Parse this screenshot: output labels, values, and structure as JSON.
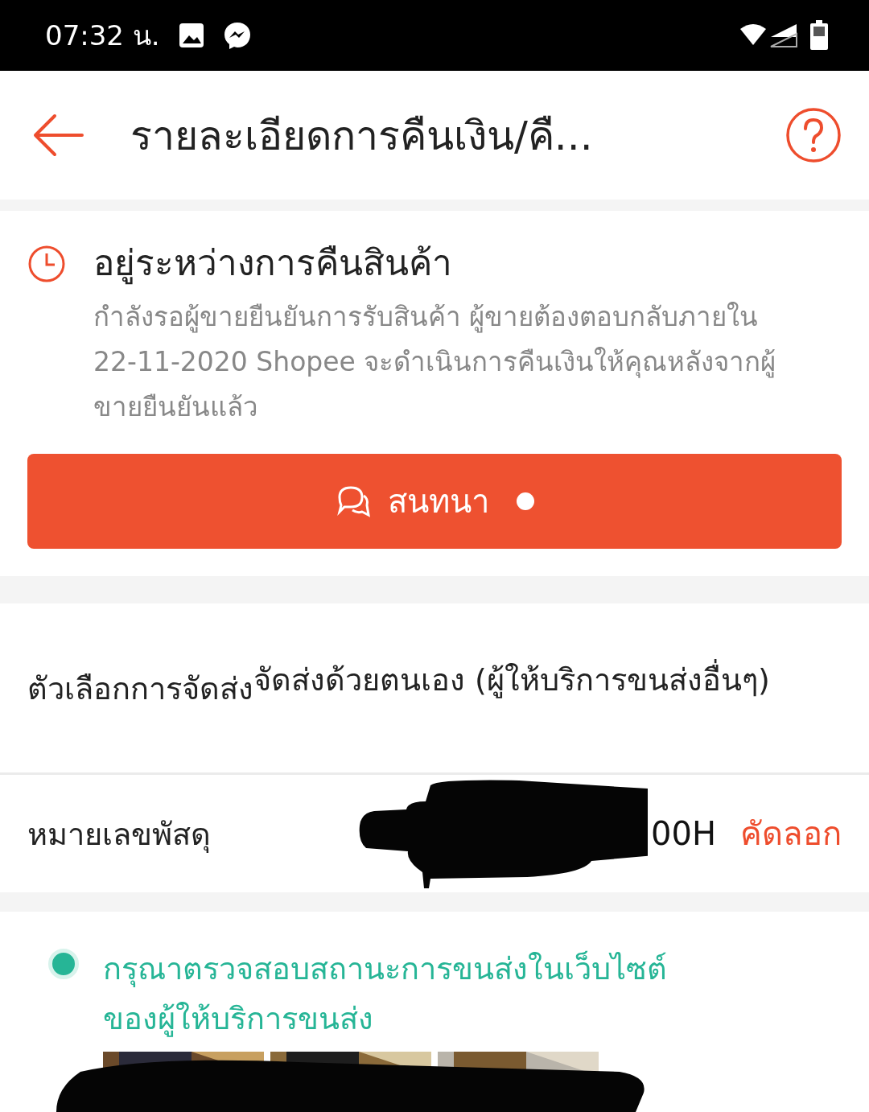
{
  "status_bar": {
    "time": "07:32 น."
  },
  "header": {
    "title": "รายละเอียดการคืนเงิน/คื..."
  },
  "return_status": {
    "title": "อยู่ระหว่างการคืนสินค้า",
    "description": "กำลังรอผู้ขายยืนยันการรับสินค้า ผู้ขายต้องตอบกลับภายใน 22-11-2020 Shopee จะดำเนินการคืนเงินให้คุณหลังจากผู้ขายยืนยันแล้ว",
    "chat_button": {
      "label": "สนทนา",
      "unread": true
    }
  },
  "details": [
    {
      "kind": "text",
      "label": "ตัวเลือกการจัดส่ง",
      "value": "จัดส่งด้วยตนเอง (ผู้ให้บริการขนส่งอื่นๆ)"
    },
    {
      "kind": "tracking",
      "label": "หมายเลขพัสดุ",
      "value": "00H",
      "action": "คัดลอก"
    }
  ],
  "timeline": [
    {
      "text": "กรุณาตรวจสอบสถานะการขนส่งในเว็บไซต์ของผู้ให้บริการขนส่ง",
      "active": true
    }
  ]
}
